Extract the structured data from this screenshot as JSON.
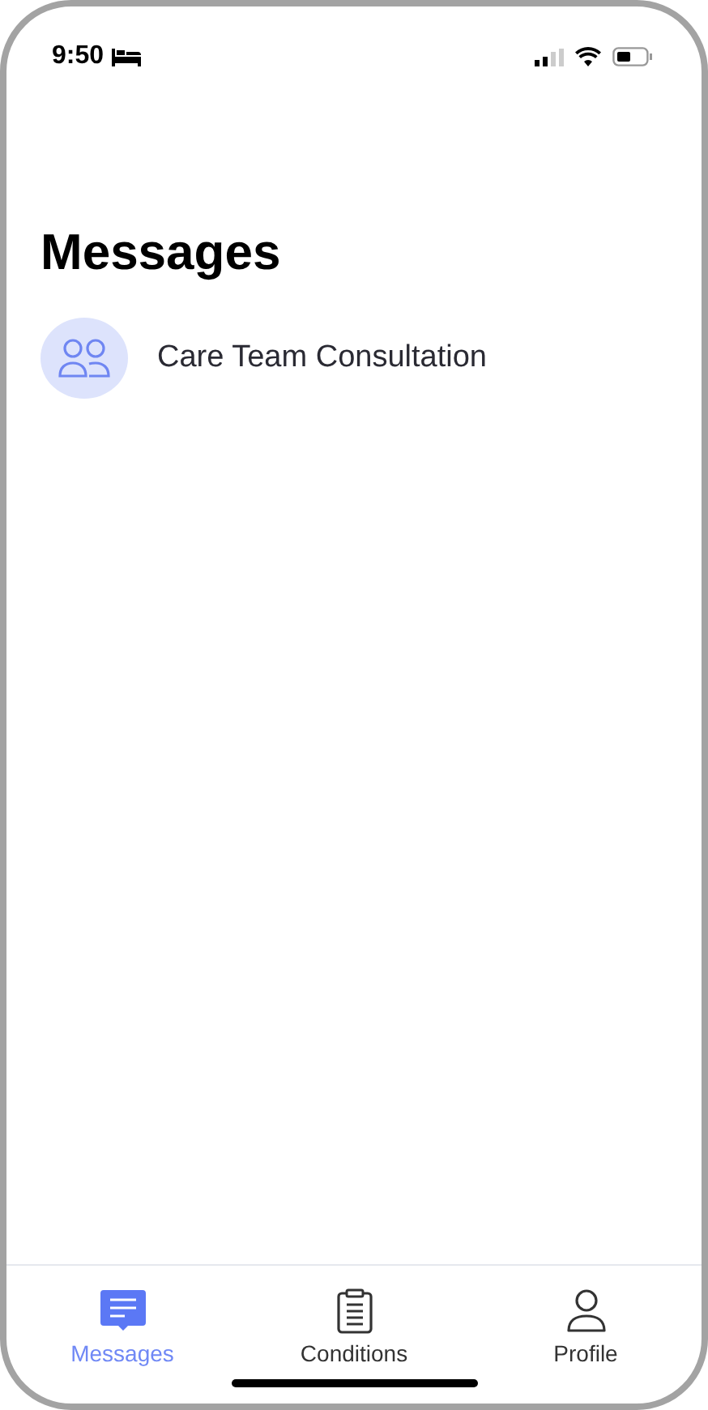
{
  "status_bar": {
    "time": "9:50"
  },
  "title": "Messages",
  "conversations": [
    {
      "name": "Care Team Consultation"
    }
  ],
  "tabs": [
    {
      "label": "Messages",
      "kind": "chat",
      "selected": true
    },
    {
      "label": "Conditions",
      "kind": "clipboard",
      "selected": false
    },
    {
      "label": "Profile",
      "kind": "person",
      "selected": false
    }
  ]
}
